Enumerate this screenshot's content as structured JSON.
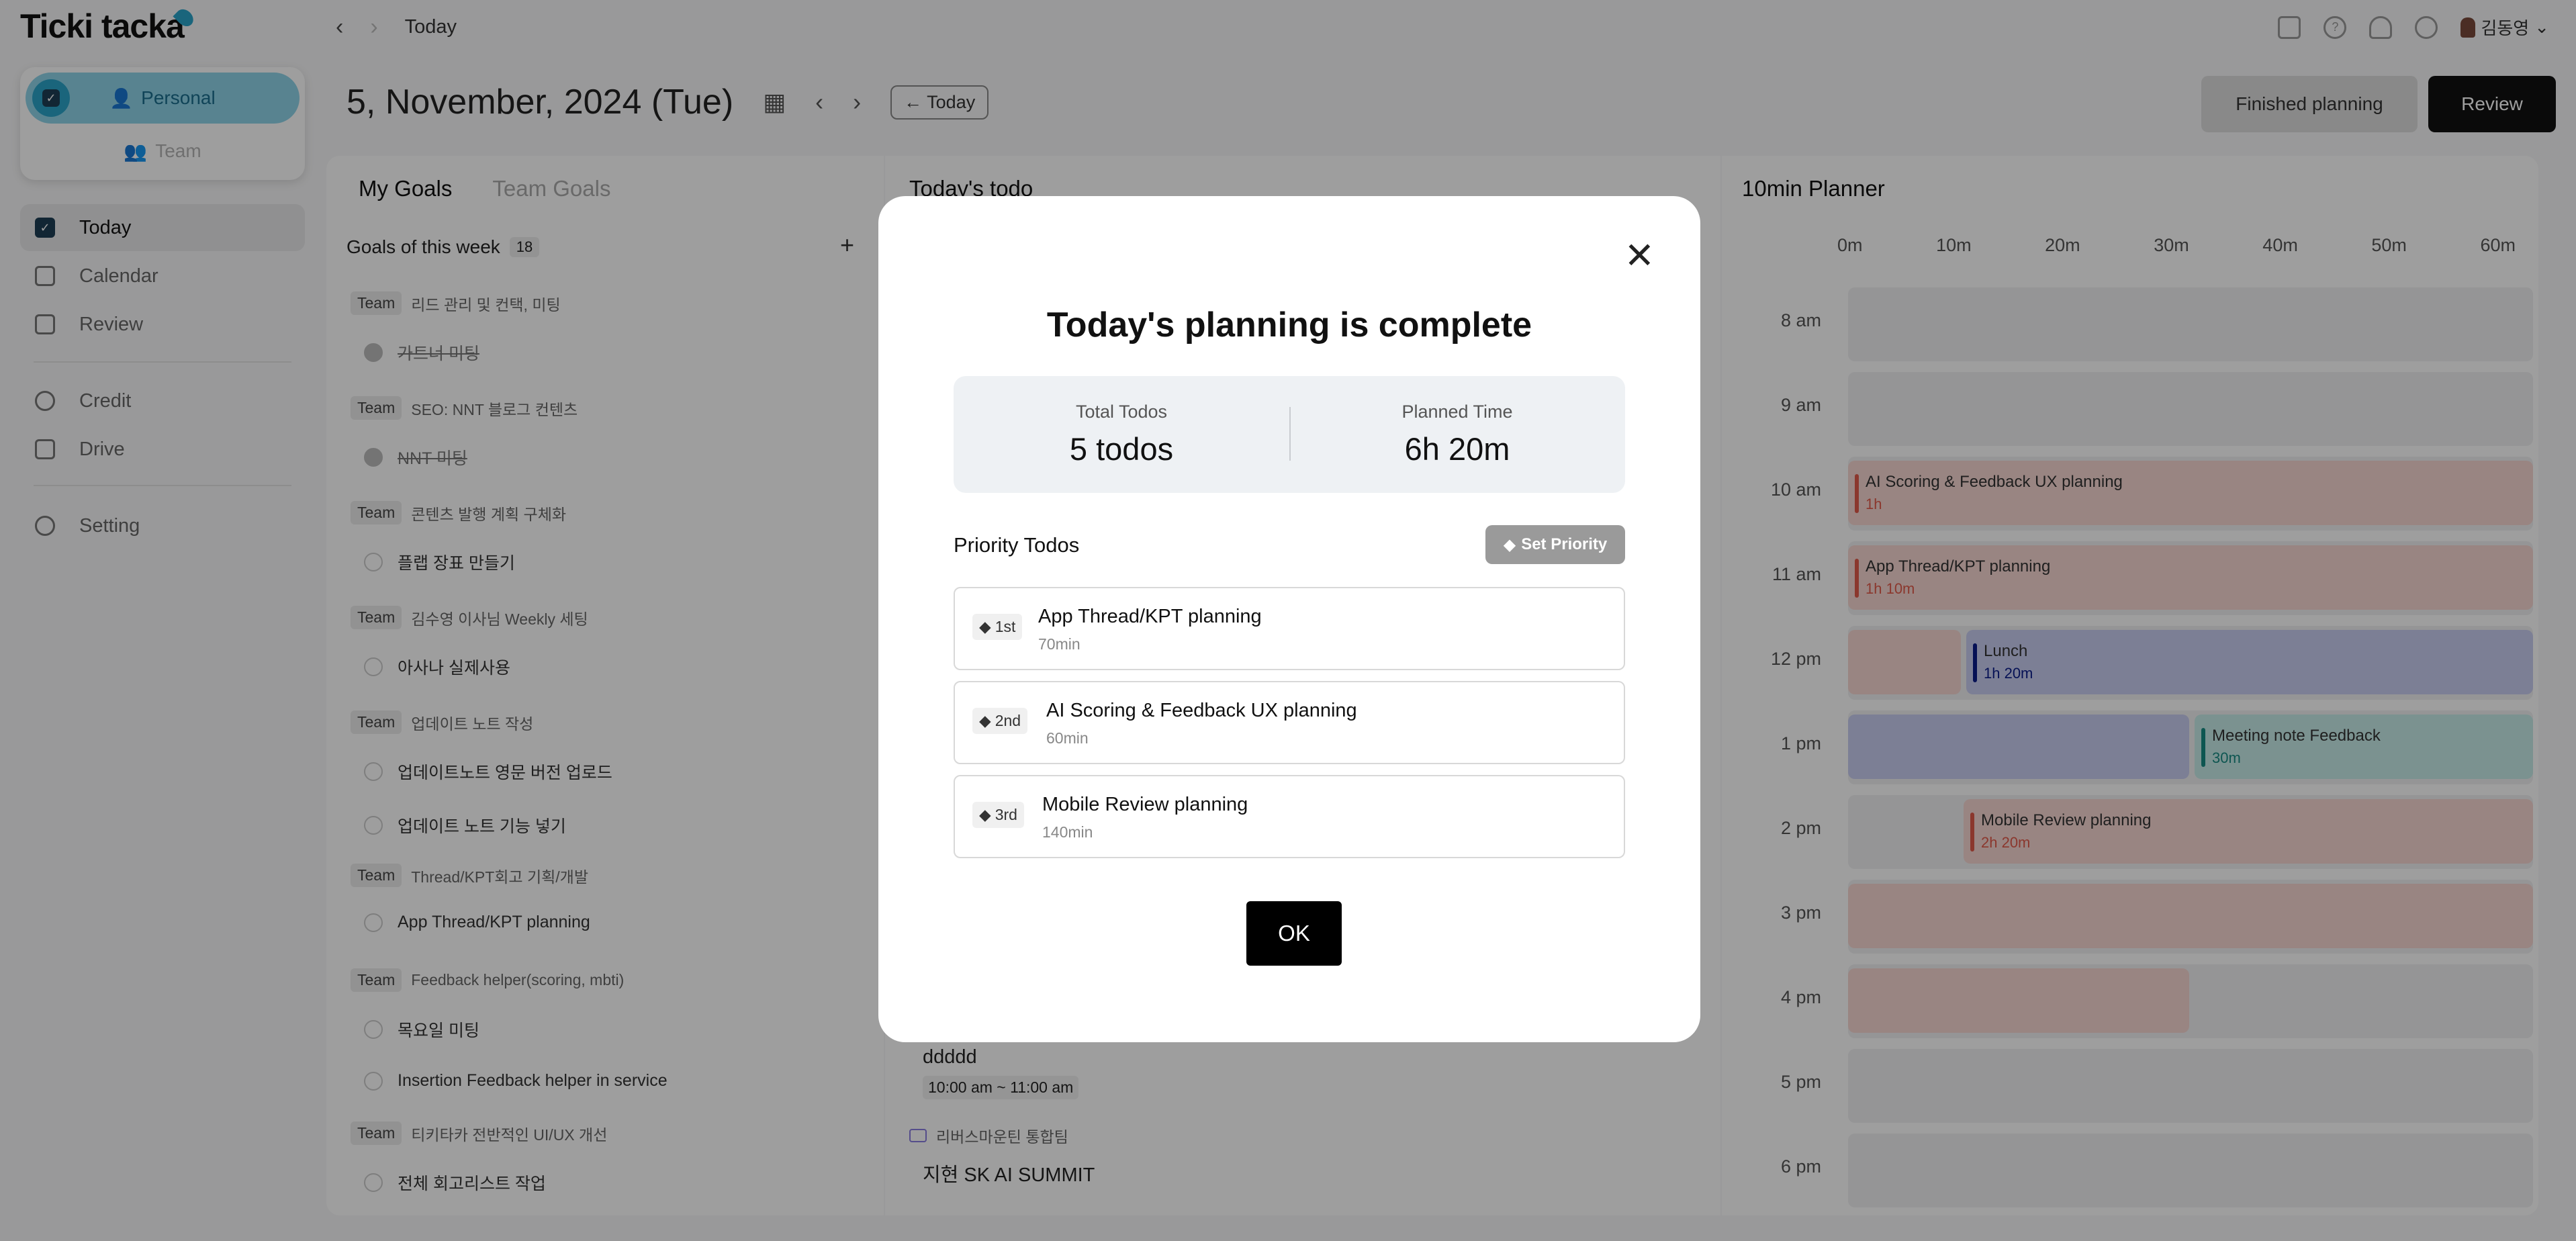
{
  "app": {
    "logo": "Ticki tacka"
  },
  "workspace": {
    "personal": "Personal",
    "team": "Team"
  },
  "sidebar": {
    "items": [
      {
        "label": "Today"
      },
      {
        "label": "Calendar"
      },
      {
        "label": "Review"
      },
      {
        "label": "Credit"
      },
      {
        "label": "Drive"
      },
      {
        "label": "Setting"
      }
    ]
  },
  "topbar": {
    "breadcrumb": "Today",
    "user": "김동영"
  },
  "header": {
    "date": "5, November, 2024 (Tue)",
    "today_button": "← Today",
    "finished_button": "Finished planning",
    "review_button": "Review"
  },
  "goals": {
    "tab_my": "My Goals",
    "tab_team": "Team Goals",
    "week_label": "Goals of this week",
    "week_count": "18",
    "add": "+",
    "groups": [
      {
        "tag": "Team",
        "title": "리드 관리 및 컨택, 미팅",
        "items": [
          {
            "text": "가트너 미팅",
            "done": true
          }
        ]
      },
      {
        "tag": "Team",
        "title": "SEO: NNT 블로그 컨텐츠",
        "items": [
          {
            "text": "NNT 미팅",
            "done": true
          }
        ]
      },
      {
        "tag": "Team",
        "title": "콘텐츠 발행 계획 구체화",
        "items": [
          {
            "text": "플랩 장표 만들기",
            "done": false
          }
        ]
      },
      {
        "tag": "Team",
        "title": "김수영 이사님 Weekly 세팅",
        "items": [
          {
            "text": "아사나 실제사용",
            "done": false
          }
        ]
      },
      {
        "tag": "Team",
        "title": "업데이트 노트 작성",
        "items": [
          {
            "text": "업데이트노트 영문 버전 업로드",
            "done": false
          },
          {
            "text": "업데이트 노트 기능 넣기",
            "done": false
          }
        ]
      },
      {
        "tag": "Team",
        "title": "Thread/KPT회고 기획/개발",
        "items": [
          {
            "text": "App Thread/KPT planning",
            "done": false
          }
        ]
      },
      {
        "tag": "Team",
        "title": "Feedback helper(scoring, mbti)",
        "items": [
          {
            "text": "목요일 미팅",
            "done": false
          },
          {
            "text": "Insertion Feedback helper in service",
            "done": false
          }
        ]
      },
      {
        "tag": "Team",
        "title": "티키타카 전반적인 UI/UX 개선",
        "items": [
          {
            "text": "전체 회고리스트 작업",
            "done": false
          }
        ]
      }
    ]
  },
  "todos": {
    "title": "Today's todo",
    "bottom_item_title": "ddddd",
    "bottom_item_time": "10:00 am ~ 11:00 am",
    "bottom_group": "리버스마운틴 통합팀",
    "bottom_item2": "지현 SK AI SUMMIT"
  },
  "planner": {
    "title": "10min Planner",
    "minutes": [
      "0m",
      "10m",
      "20m",
      "30m",
      "40m",
      "50m",
      "60m"
    ],
    "hours": [
      "8 am",
      "9 am",
      "10 am",
      "11 am",
      "12 pm",
      "1 pm",
      "2 pm",
      "3 pm",
      "4 pm",
      "5 pm",
      "6 pm"
    ],
    "events": [
      {
        "title": "AI Scoring & Feedback UX planning",
        "duration": "1h"
      },
      {
        "title": "App Thread/KPT planning",
        "duration": "1h 10m"
      },
      {
        "title": "Lunch",
        "duration": "1h 20m"
      },
      {
        "title": "Meeting note Feedback",
        "duration": "30m"
      },
      {
        "title": "Mobile Review planning",
        "duration": "2h 20m"
      }
    ]
  },
  "modal": {
    "title": "Today's planning is complete",
    "total_label": "Total Todos",
    "total_value": "5 todos",
    "planned_label": "Planned Time",
    "planned_value": "6h 20m",
    "priority_title": "Priority Todos",
    "set_priority": "Set Priority",
    "priorities": [
      {
        "rank": "1st",
        "name": "App Thread/KPT planning",
        "minutes": "70min"
      },
      {
        "rank": "2nd",
        "name": "AI Scoring & Feedback UX planning",
        "minutes": "60min"
      },
      {
        "rank": "3rd",
        "name": "Mobile Review planning",
        "minutes": "140min"
      }
    ],
    "ok": "OK"
  },
  "colors": {
    "accent": "#2ba3c9",
    "event_red_bg": "#f7d7d2",
    "event_red_bar": "#e05a4a",
    "event_blue_bg": "#c9cdf0",
    "event_blue_bar": "#0a1c8a",
    "event_teal_bg": "#c7ece9",
    "event_teal_bar": "#178b84"
  }
}
